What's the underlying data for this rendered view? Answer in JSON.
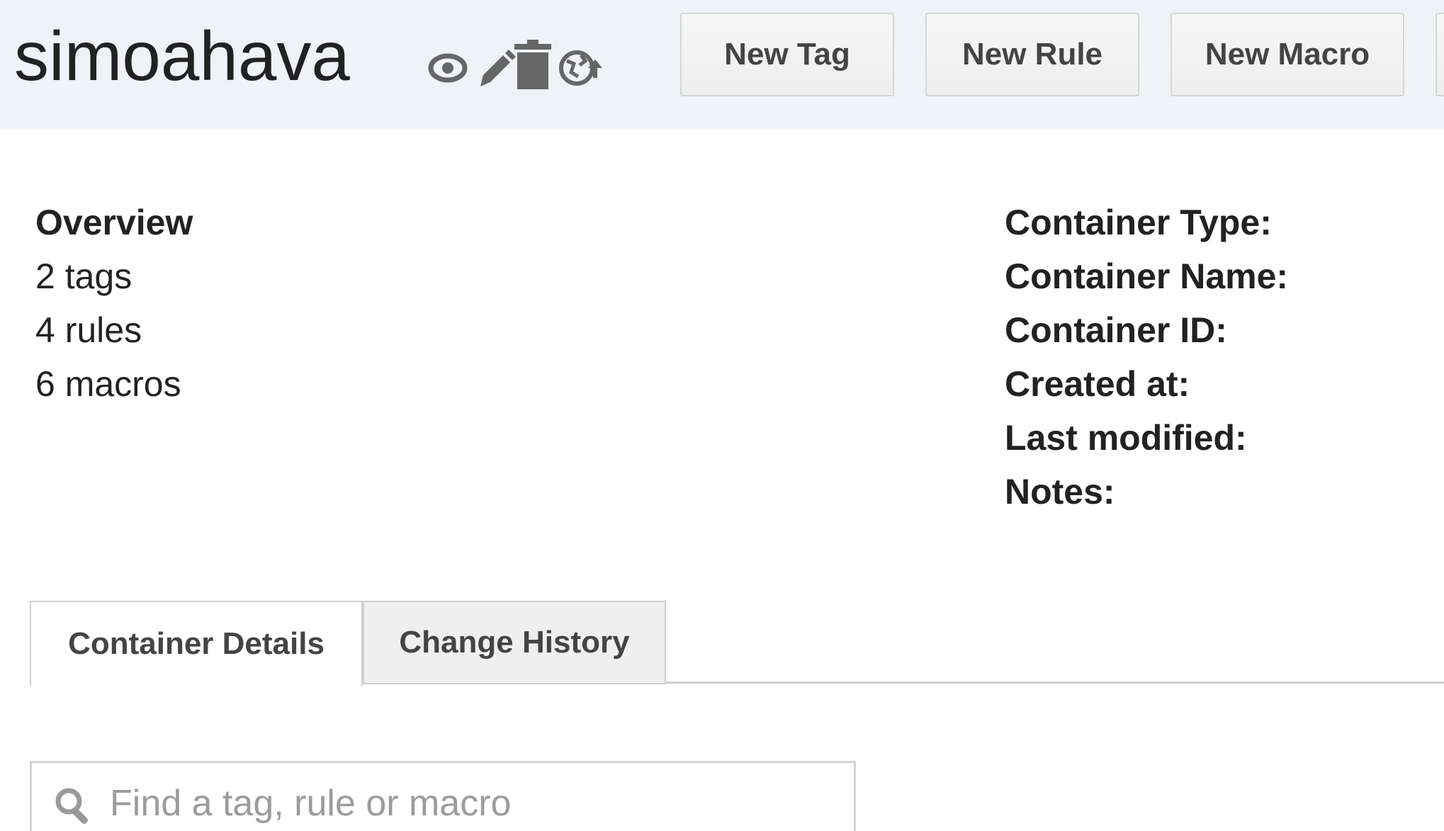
{
  "header": {
    "container_name": "simoahava",
    "icons": [
      "eye-icon",
      "pencil-icon",
      "trash-icon",
      "publish-icon"
    ],
    "buttons": {
      "new_tag": "New Tag",
      "new_rule": "New Rule",
      "new_macro": "New Macro"
    },
    "background": "#eff2f7"
  },
  "overview": {
    "title": "Overview",
    "tags": "2 tags",
    "rules": "4 rules",
    "macros": "6 macros"
  },
  "details": {
    "container_type": "Container Type:",
    "container_name": "Container Name:",
    "container_id": "Container ID:",
    "created_at": "Created at:",
    "last_modified": "Last modified:",
    "notes": "Notes:"
  },
  "tabs": [
    {
      "label": "Container Details",
      "active": true
    },
    {
      "label": "Change History",
      "active": false
    }
  ],
  "search": {
    "placeholder": "Find a tag, rule or macro",
    "value": ""
  }
}
